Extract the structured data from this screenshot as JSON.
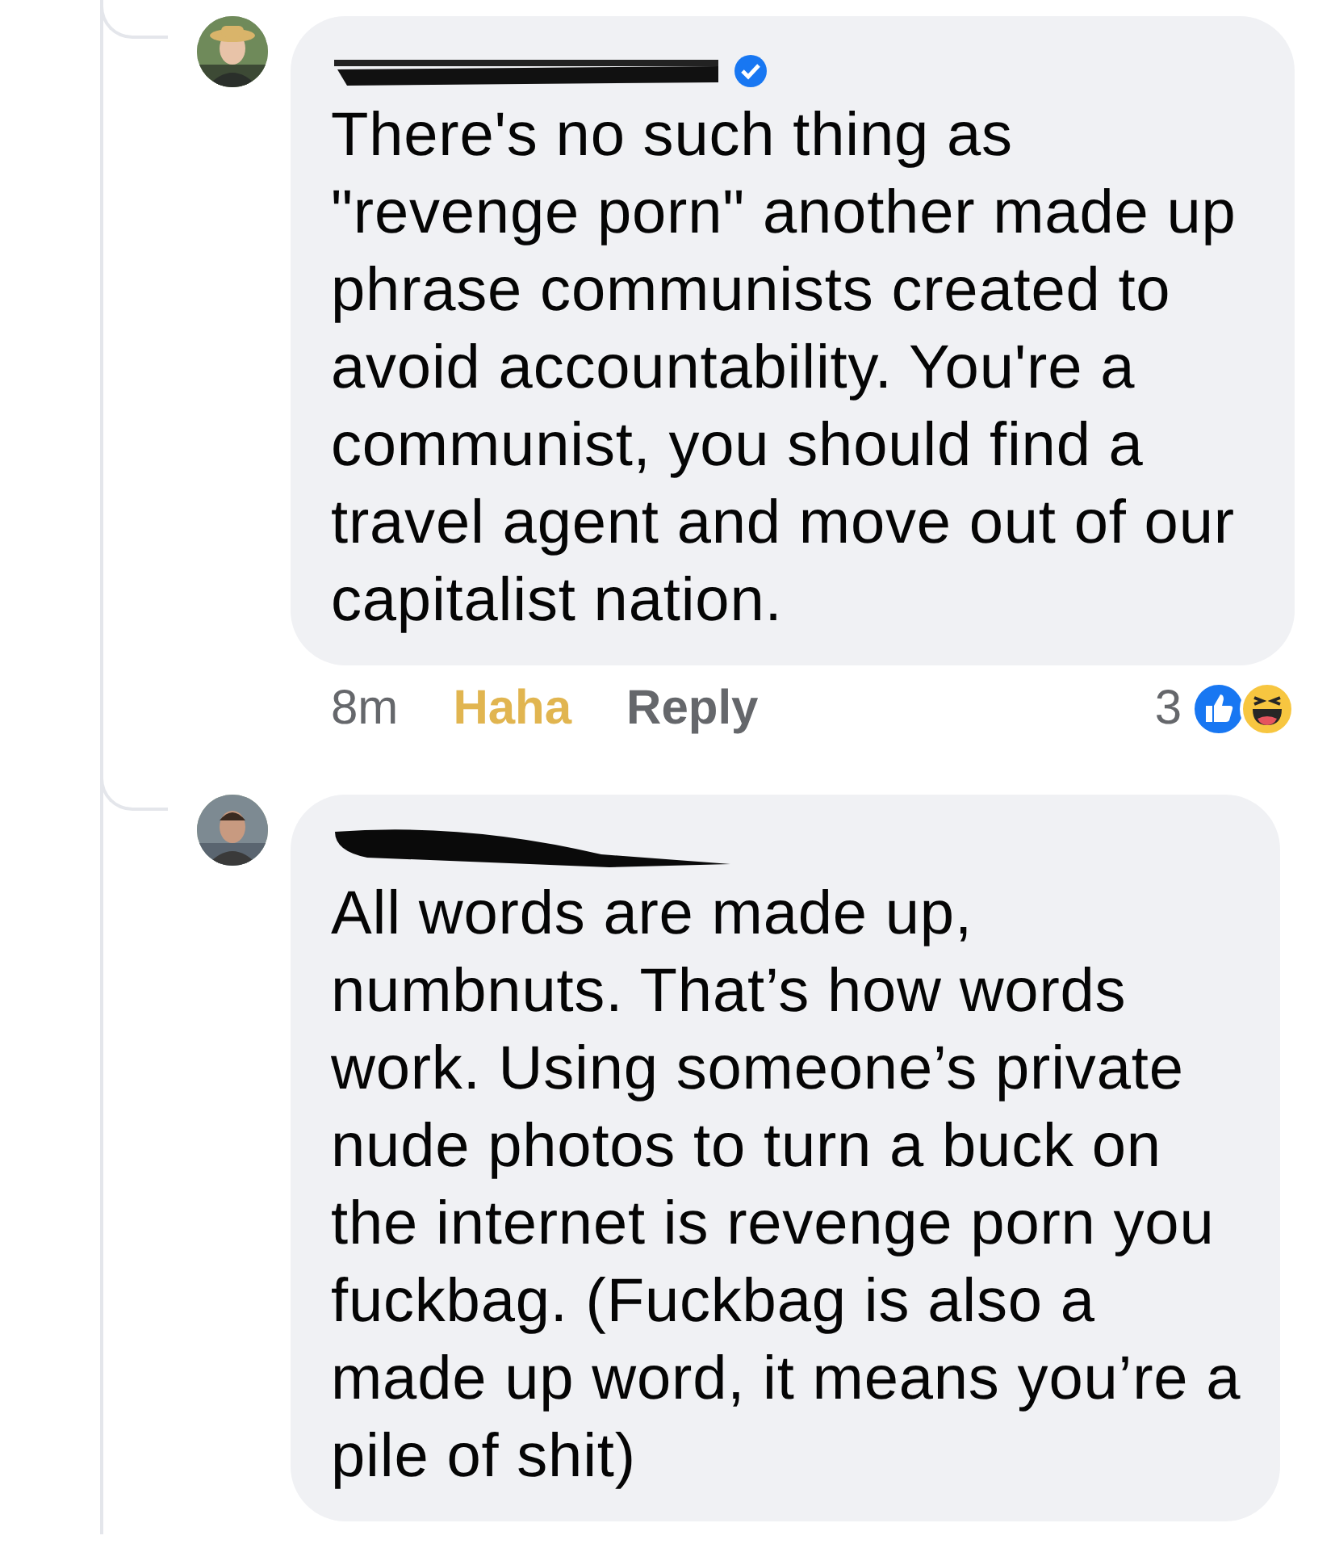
{
  "comments": [
    {
      "verified": true,
      "text": "There's no such thing as \"revenge porn\" another made up phrase communists created to avoid accountability. You're a communist, you should find a travel agent and move out of our capitalist nation.",
      "actions": {
        "time": "8m",
        "reaction_label": "Haha",
        "reacted": true,
        "reply": "Reply",
        "reaction_count": "3"
      }
    },
    {
      "verified": false,
      "text": "All words are made up, numbnuts. That’s how words work. Using someone’s private nude photos to turn a buck on the internet is revenge porn you fuckbag. (Fuckbag is also a made up word, it means you’re a pile of shit)"
    }
  ]
}
